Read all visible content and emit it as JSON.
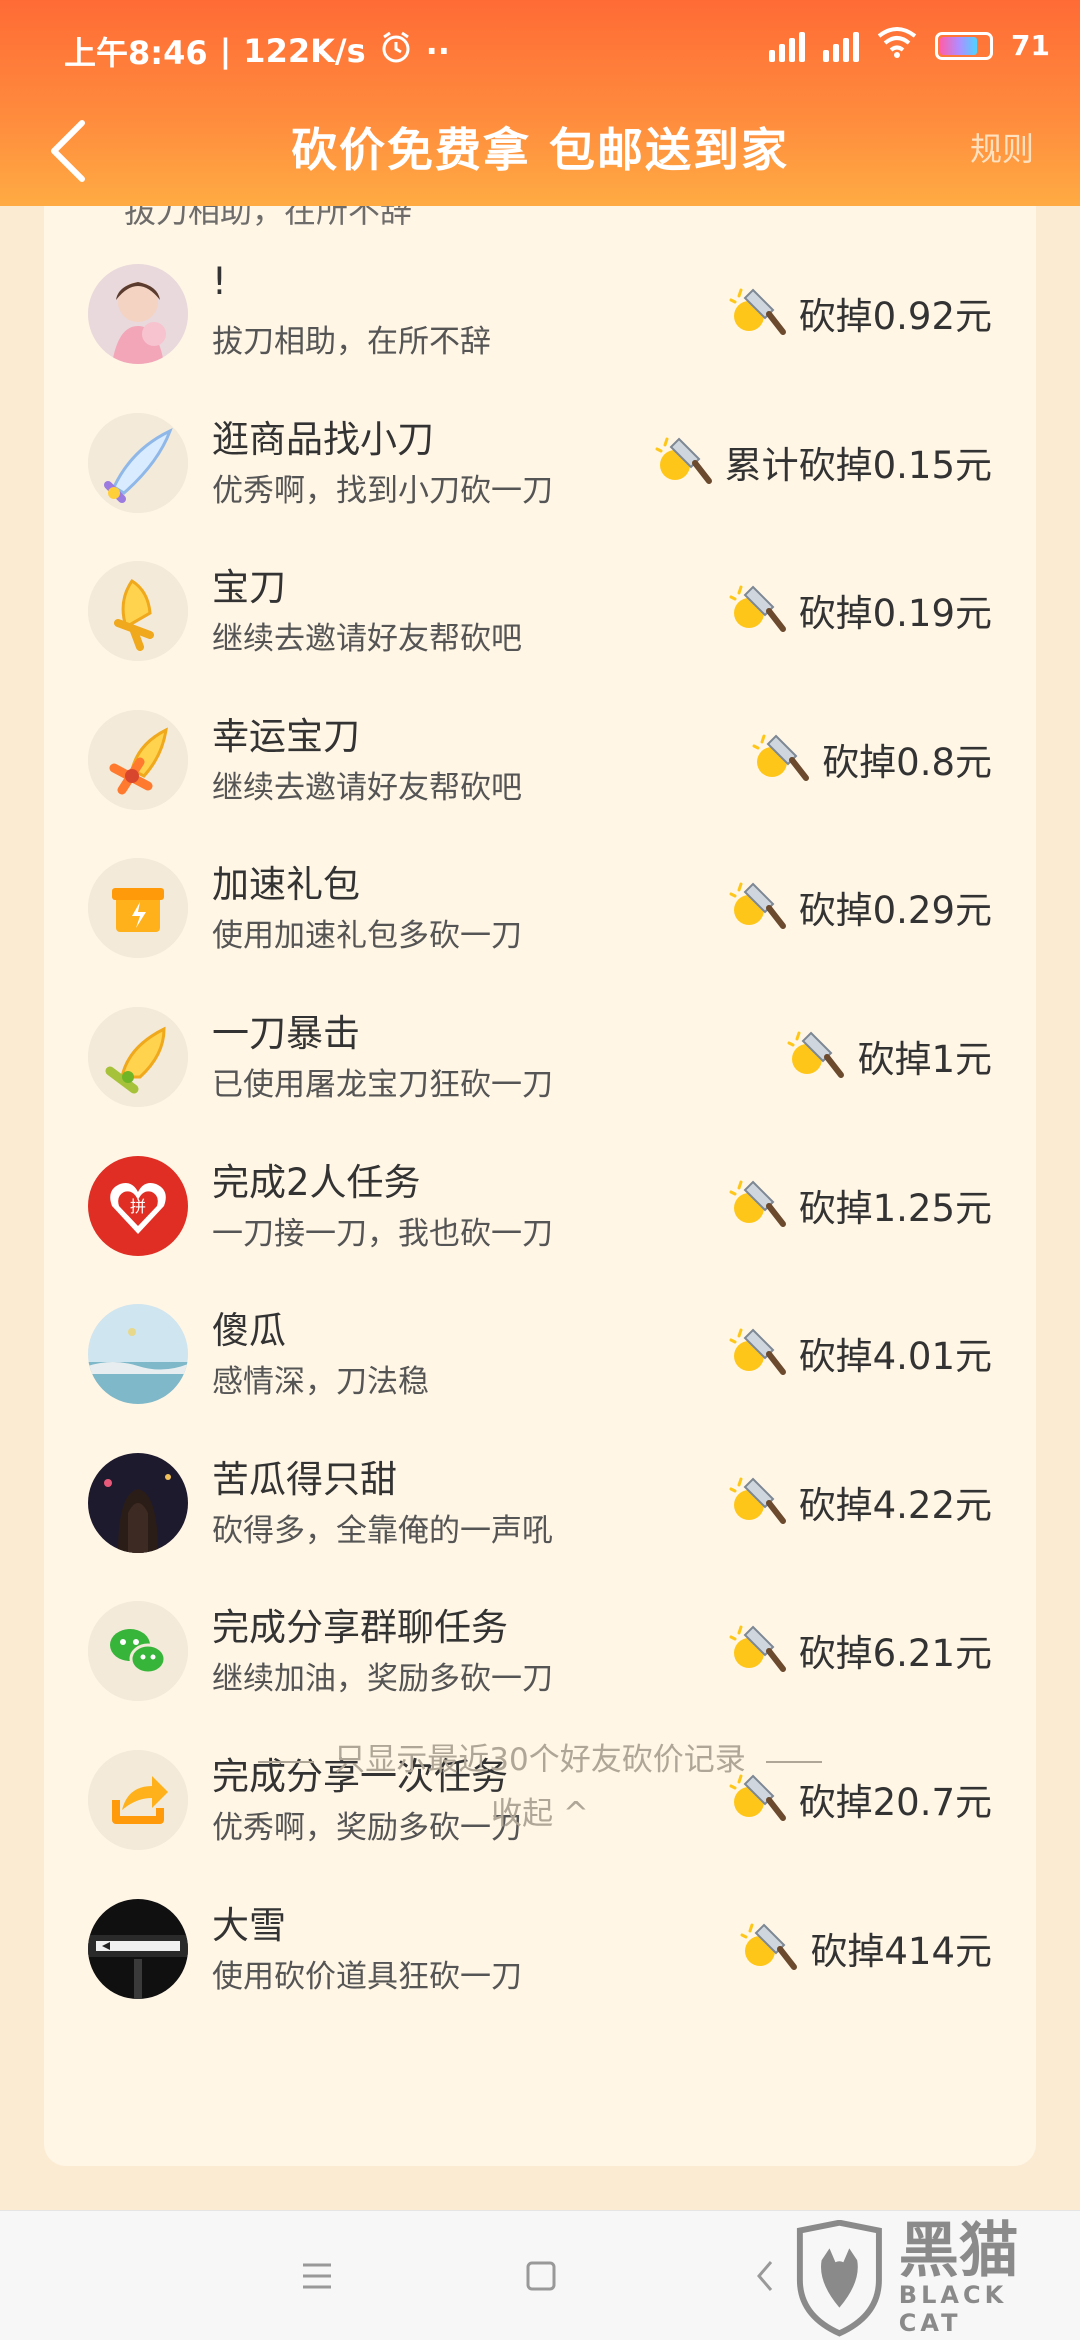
{
  "status_bar": {
    "time": "上午8:46",
    "speed": "122K/s",
    "battery": "71",
    "battery_level": 0.71
  },
  "nav": {
    "title": "砍价免费拿 包邮送到家",
    "rules": "规则"
  },
  "partial_row": {
    "desc": "拔刀相助，在所不辞"
  },
  "records": [
    {
      "name": "!",
      "desc": "拔刀相助，在所不辞",
      "amount": "砍掉0.92元",
      "avatar_icon": "girl-photo-avatar"
    },
    {
      "name": "逛商品找小刀",
      "desc": "优秀啊，找到小刀砍一刀",
      "amount": "累计砍掉0.15元",
      "avatar_icon": "small-knife-icon"
    },
    {
      "name": "宝刀",
      "desc": "继续去邀请好友帮砍吧",
      "amount": "砍掉0.19元",
      "avatar_icon": "golden-sword-icon"
    },
    {
      "name": "幸运宝刀",
      "desc": "继续去邀请好友帮砍吧",
      "amount": "砍掉0.8元",
      "avatar_icon": "lucky-sword-icon"
    },
    {
      "name": "加速礼包",
      "desc": "使用加速礼包多砍一刀",
      "amount": "砍掉0.29元",
      "avatar_icon": "gift-box-icon"
    },
    {
      "name": "一刀暴击",
      "desc": "已使用屠龙宝刀狂砍一刀",
      "amount": "砍掉1元",
      "avatar_icon": "critical-sword-icon"
    },
    {
      "name": "完成2人任务",
      "desc": "一刀接一刀，我也砍一刀",
      "amount": "砍掉1.25元",
      "avatar_icon": "pinduoduo-logo-icon"
    },
    {
      "name": "傻瓜",
      "desc": "感情深，刀法稳",
      "amount": "砍掉4.01元",
      "avatar_icon": "beach-photo-avatar"
    },
    {
      "name": "苦瓜得只甜",
      "desc": "砍得多，全靠俺的一声吼",
      "amount": "砍掉4.22元",
      "avatar_icon": "night-photo-avatar"
    },
    {
      "name": "完成分享群聊任务",
      "desc": "继续加油，奖励多砍一刀",
      "amount": "砍掉6.21元",
      "avatar_icon": "wechat-icon"
    },
    {
      "name": "完成分享一次任务",
      "desc": "优秀啊，奖励多砍一刀",
      "amount": "砍掉20.7元",
      "avatar_icon": "share-arrow-icon"
    },
    {
      "name": "大雪",
      "desc": "使用砍价道具狂砍一刀",
      "amount": "砍掉414元",
      "avatar_icon": "subway-photo-avatar"
    }
  ],
  "footer": {
    "note": "只显示最近30个好友砍价记录",
    "collapse": "收起 ^"
  },
  "watermark": {
    "cn": "黑猫",
    "en": "BLACK CAT"
  },
  "colors": {
    "header_top": "#ff6b35",
    "header_bottom": "#ffab43",
    "page_bg": "#fbebd2",
    "card_bg": "#fff6e6"
  }
}
